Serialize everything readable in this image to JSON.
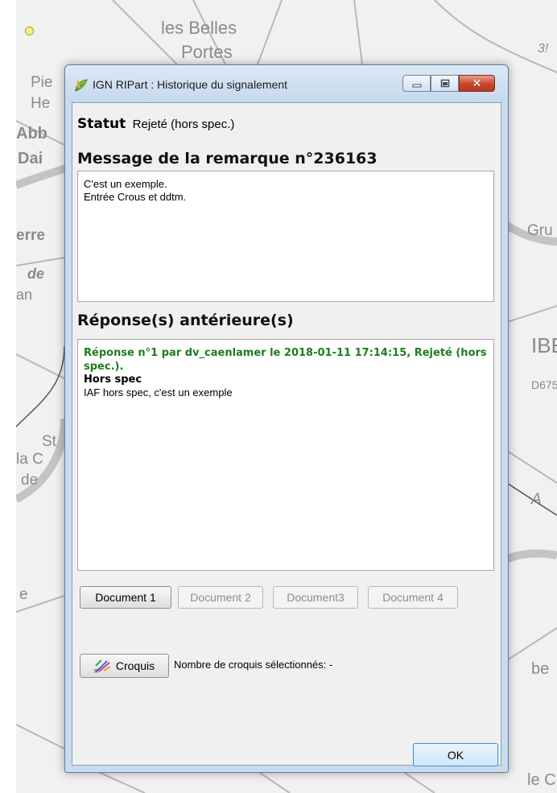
{
  "map": {
    "labels": [
      "les Belles",
      "Portes",
      "Pie",
      "He",
      "Abb",
      "Dai",
      "erre",
      "de",
      "an",
      "Gru",
      "IBE",
      "D675",
      "St",
      "la C",
      "de",
      "A",
      "e",
      "be",
      "le C",
      "3!"
    ]
  },
  "window": {
    "title": "IGN RIPart : Historique du signalement",
    "close_glyph": "✕"
  },
  "status": {
    "label": "Statut",
    "value": "Rejeté (hors spec.)"
  },
  "message": {
    "heading": "Message de la remarque n°236163",
    "lines": [
      "C'est un exemple.",
      "Entrée Crous et ddtm."
    ]
  },
  "responses": {
    "heading": "Réponse(s) antérieure(s)",
    "reply_header": "Réponse n°1 par dv_caenlamer le 2018-01-11 17:14:15, Rejeté (hors spec.).",
    "reply_title": "Hors spec",
    "reply_body": "IAF hors spec, c'est un exemple"
  },
  "documents": {
    "buttons": [
      {
        "label": "Document 1",
        "enabled": true
      },
      {
        "label": "Document 2",
        "enabled": false
      },
      {
        "label": "Document3",
        "enabled": false
      },
      {
        "label": "Document 4",
        "enabled": false
      }
    ]
  },
  "croquis": {
    "button_label": "Croquis",
    "count_text": "Nombre de croquis sélectionnés: -"
  },
  "ok_label": "OK",
  "colors": {
    "reply_header": "#1d7d1d",
    "close_button": "#c7452c",
    "title_bar": "#c5d8ec"
  }
}
